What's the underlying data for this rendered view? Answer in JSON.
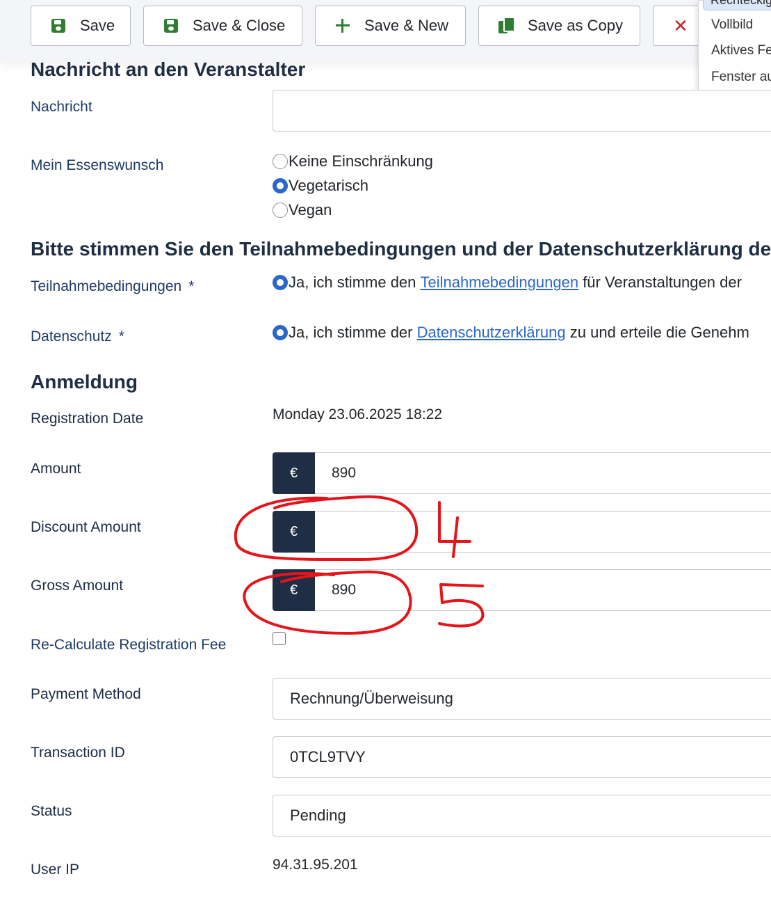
{
  "toolbar": {
    "save": "Save",
    "save_close": "Save & Close",
    "save_new": "Save & New",
    "save_copy": "Save as Copy",
    "close_icon": "close-icon"
  },
  "context_menu": {
    "items": [
      "Rechteckig",
      "Vollbild",
      "Aktives Fe",
      "Fenster au"
    ]
  },
  "section_message": {
    "title": "Nachricht an den Veranstalter",
    "message_label": "Nachricht",
    "message_value": "",
    "food_label": "Mein Essenswunsch",
    "food_options": [
      "Keine Einschränkung",
      "Vegetarisch",
      "Vegan"
    ],
    "food_selected": "Vegetarisch"
  },
  "section_consent": {
    "title": "Bitte stimmen Sie den Teilnahmebedingungen und der Datenschutzerklärung der G",
    "terms_label": "Teilnahmebedingungen",
    "terms_pre": "Ja, ich stimme den ",
    "terms_link": "Teilnahmebedingungen",
    "terms_post": " für Veranstaltungen der",
    "privacy_label": "Datenschutz",
    "privacy_pre": "Ja, ich stimme der ",
    "privacy_link": "Datenschutzerklärung",
    "privacy_post": " zu und erteile die Genehm",
    "required_mark": "*"
  },
  "section_registration": {
    "title": "Anmeldung",
    "registration_date_label": "Registration Date",
    "registration_date_value": "Monday 23.06.2025 18:22",
    "amount_label": "Amount",
    "amount_value": "890",
    "discount_label": "Discount Amount",
    "discount_value": "",
    "gross_label": "Gross Amount",
    "gross_value": "890",
    "currency_symbol": "€",
    "recalc_label": "Re-Calculate Registration Fee",
    "payment_method_label": "Payment Method",
    "payment_method_value": "Rechnung/Überweisung",
    "transaction_label": "Transaction ID",
    "transaction_value": "0TCL9TVY",
    "status_label": "Status",
    "status_value": "Pending",
    "user_ip_label": "User IP",
    "user_ip_value": "94.31.95.201"
  },
  "annotations": {
    "mark_4": "4",
    "mark_5": "5",
    "color": "#e5141a"
  }
}
